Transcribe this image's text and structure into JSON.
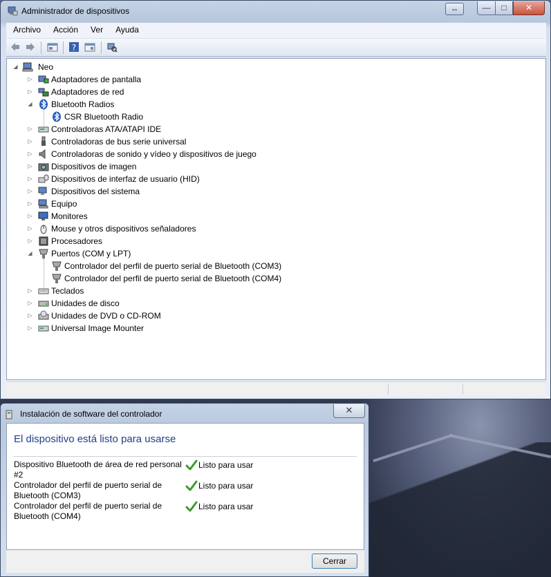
{
  "window": {
    "title": "Administrador de dispositivos",
    "title_icon": "device-manager-icon",
    "controls": {
      "minimize": "—",
      "maximize": "□",
      "close": "✕",
      "extra": "⇔"
    }
  },
  "menu": [
    "Archivo",
    "Acción",
    "Ver",
    "Ayuda"
  ],
  "toolbar": {
    "icons": [
      "back-arrow-icon",
      "forward-arrow-icon",
      "properties-icon",
      "help-icon",
      "view-icon",
      "scan-hardware-icon"
    ]
  },
  "tree": {
    "root": "Neo",
    "items": [
      {
        "label": "Adaptadores de pantalla",
        "icon": "display-adapter-icon",
        "expanded": false,
        "level": 1
      },
      {
        "label": "Adaptadores de red",
        "icon": "network-adapter-icon",
        "expanded": false,
        "level": 1
      },
      {
        "label": "Bluetooth Radios",
        "icon": "bluetooth-icon",
        "expanded": true,
        "level": 1
      },
      {
        "label": "CSR Bluetooth Radio",
        "icon": "bluetooth-icon",
        "expanded": null,
        "level": 2
      },
      {
        "label": "Controladoras ATA/ATAPI IDE",
        "icon": "ide-controller-icon",
        "expanded": false,
        "level": 1
      },
      {
        "label": "Controladoras de bus serie universal",
        "icon": "usb-icon",
        "expanded": false,
        "level": 1
      },
      {
        "label": "Controladoras de sonido y vídeo y dispositivos de juego",
        "icon": "speaker-icon",
        "expanded": false,
        "level": 1
      },
      {
        "label": "Dispositivos de imagen",
        "icon": "camera-icon",
        "expanded": false,
        "level": 1
      },
      {
        "label": "Dispositivos de interfaz de usuario (HID)",
        "icon": "hid-icon",
        "expanded": false,
        "level": 1
      },
      {
        "label": "Dispositivos del sistema",
        "icon": "system-device-icon",
        "expanded": false,
        "level": 1
      },
      {
        "label": "Equipo",
        "icon": "computer-icon",
        "expanded": false,
        "level": 1
      },
      {
        "label": "Monitores",
        "icon": "monitor-icon",
        "expanded": false,
        "level": 1
      },
      {
        "label": "Mouse y otros dispositivos señaladores",
        "icon": "mouse-icon",
        "expanded": false,
        "level": 1
      },
      {
        "label": "Procesadores",
        "icon": "processor-icon",
        "expanded": false,
        "level": 1
      },
      {
        "label": "Puertos (COM y LPT)",
        "icon": "port-icon",
        "expanded": true,
        "level": 1
      },
      {
        "label": "Controlador del perfil de puerto serial de Bluetooth (COM3)",
        "icon": "port-icon",
        "expanded": null,
        "level": 2
      },
      {
        "label": "Controlador del perfil de puerto serial de Bluetooth (COM4)",
        "icon": "port-icon",
        "expanded": null,
        "level": 2
      },
      {
        "label": "Teclados",
        "icon": "keyboard-icon",
        "expanded": false,
        "level": 1
      },
      {
        "label": "Unidades de disco",
        "icon": "disk-drive-icon",
        "expanded": false,
        "level": 1
      },
      {
        "label": "Unidades de DVD o CD-ROM",
        "icon": "dvd-drive-icon",
        "expanded": false,
        "level": 1
      },
      {
        "label": "Universal Image Mounter",
        "icon": "image-mounter-icon",
        "expanded": false,
        "level": 1
      }
    ]
  },
  "dialog": {
    "title": "Instalación de software del controlador",
    "close": "✕",
    "heading": "El dispositivo está listo para usarse",
    "items": [
      {
        "name": "Dispositivo Bluetooth de área de red personal #2",
        "status": "Listo para usar"
      },
      {
        "name": "Controlador del perfil de puerto serial de Bluetooth (COM3)",
        "status": "Listo para usar"
      },
      {
        "name": "Controlador del perfil de puerto serial de Bluetooth (COM4)",
        "status": "Listo para usar"
      }
    ],
    "button": "Cerrar"
  },
  "colors": {
    "heading": "#1e3f8a",
    "check": "#3a9a2a",
    "close_button": "#c9533f"
  }
}
